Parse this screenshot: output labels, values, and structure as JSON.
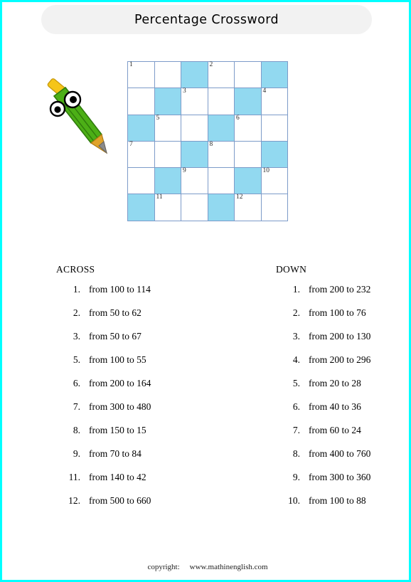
{
  "page": {
    "border_color": "#00ffff",
    "background": "#ffffff"
  },
  "header": {
    "title": "Percentage Crossword",
    "banner_color": "#f2f2f2"
  },
  "mascot": {
    "icon": "pencil-character-icon",
    "body_color": "#4caf16",
    "eraser_color": "#f5c518",
    "tip_color": "#8a8a8a"
  },
  "grid": {
    "rows": 6,
    "cols": 6,
    "shaded_color": "#92d9f0",
    "empty_color": "#ffffff",
    "border_color": "#7d9bc9",
    "cells": [
      [
        {
          "shaded": false,
          "number": "1"
        },
        {
          "shaded": false,
          "number": ""
        },
        {
          "shaded": true,
          "number": ""
        },
        {
          "shaded": false,
          "number": "2"
        },
        {
          "shaded": false,
          "number": ""
        },
        {
          "shaded": true,
          "number": ""
        }
      ],
      [
        {
          "shaded": false,
          "number": ""
        },
        {
          "shaded": true,
          "number": ""
        },
        {
          "shaded": false,
          "number": "3"
        },
        {
          "shaded": false,
          "number": ""
        },
        {
          "shaded": true,
          "number": ""
        },
        {
          "shaded": false,
          "number": "4"
        }
      ],
      [
        {
          "shaded": true,
          "number": ""
        },
        {
          "shaded": false,
          "number": "5"
        },
        {
          "shaded": false,
          "number": ""
        },
        {
          "shaded": true,
          "number": ""
        },
        {
          "shaded": false,
          "number": "6"
        },
        {
          "shaded": false,
          "number": ""
        }
      ],
      [
        {
          "shaded": false,
          "number": "7"
        },
        {
          "shaded": false,
          "number": ""
        },
        {
          "shaded": true,
          "number": ""
        },
        {
          "shaded": false,
          "number": "8"
        },
        {
          "shaded": false,
          "number": ""
        },
        {
          "shaded": true,
          "number": ""
        }
      ],
      [
        {
          "shaded": false,
          "number": ""
        },
        {
          "shaded": true,
          "number": ""
        },
        {
          "shaded": false,
          "number": "9"
        },
        {
          "shaded": false,
          "number": ""
        },
        {
          "shaded": true,
          "number": ""
        },
        {
          "shaded": false,
          "number": "10"
        }
      ],
      [
        {
          "shaded": true,
          "number": ""
        },
        {
          "shaded": false,
          "number": "11"
        },
        {
          "shaded": false,
          "number": ""
        },
        {
          "shaded": true,
          "number": ""
        },
        {
          "shaded": false,
          "number": "12"
        },
        {
          "shaded": false,
          "number": ""
        }
      ]
    ]
  },
  "clues": {
    "across": {
      "heading": "ACROSS",
      "items": [
        {
          "num": "1.",
          "text": "from 100 to 114"
        },
        {
          "num": "2.",
          "text": "from 50 to 62"
        },
        {
          "num": "3.",
          "text": "from 50 to 67"
        },
        {
          "num": "5.",
          "text": "from 100 to 55"
        },
        {
          "num": "6.",
          "text": "from 200 to 164"
        },
        {
          "num": "7.",
          "text": "from 300 to 480"
        },
        {
          "num": "8.",
          "text": "from 150 to 15"
        },
        {
          "num": "9.",
          "text": "from 70 to 84"
        },
        {
          "num": "11.",
          "text": "from 140 to 42"
        },
        {
          "num": "12.",
          "text": "from 500 to 660"
        }
      ]
    },
    "down": {
      "heading": "DOWN",
      "items": [
        {
          "num": "1.",
          "text": "from 200 to 232"
        },
        {
          "num": "2.",
          "text": "from 100 to 76"
        },
        {
          "num": "3.",
          "text": "from 200 to 130"
        },
        {
          "num": "4.",
          "text": "from 200 to 296"
        },
        {
          "num": "5.",
          "text": "from 20 to 28"
        },
        {
          "num": "6.",
          "text": "from 40 to 36"
        },
        {
          "num": "7.",
          "text": "from 60 to 24"
        },
        {
          "num": "8.",
          "text": "from 400 to 760"
        },
        {
          "num": "9.",
          "text": "from 300 to 360"
        },
        {
          "num": "10.",
          "text": "from 100 to 88"
        }
      ]
    }
  },
  "footer": {
    "label": "copyright:",
    "url": "www.mathinenglish.com"
  }
}
